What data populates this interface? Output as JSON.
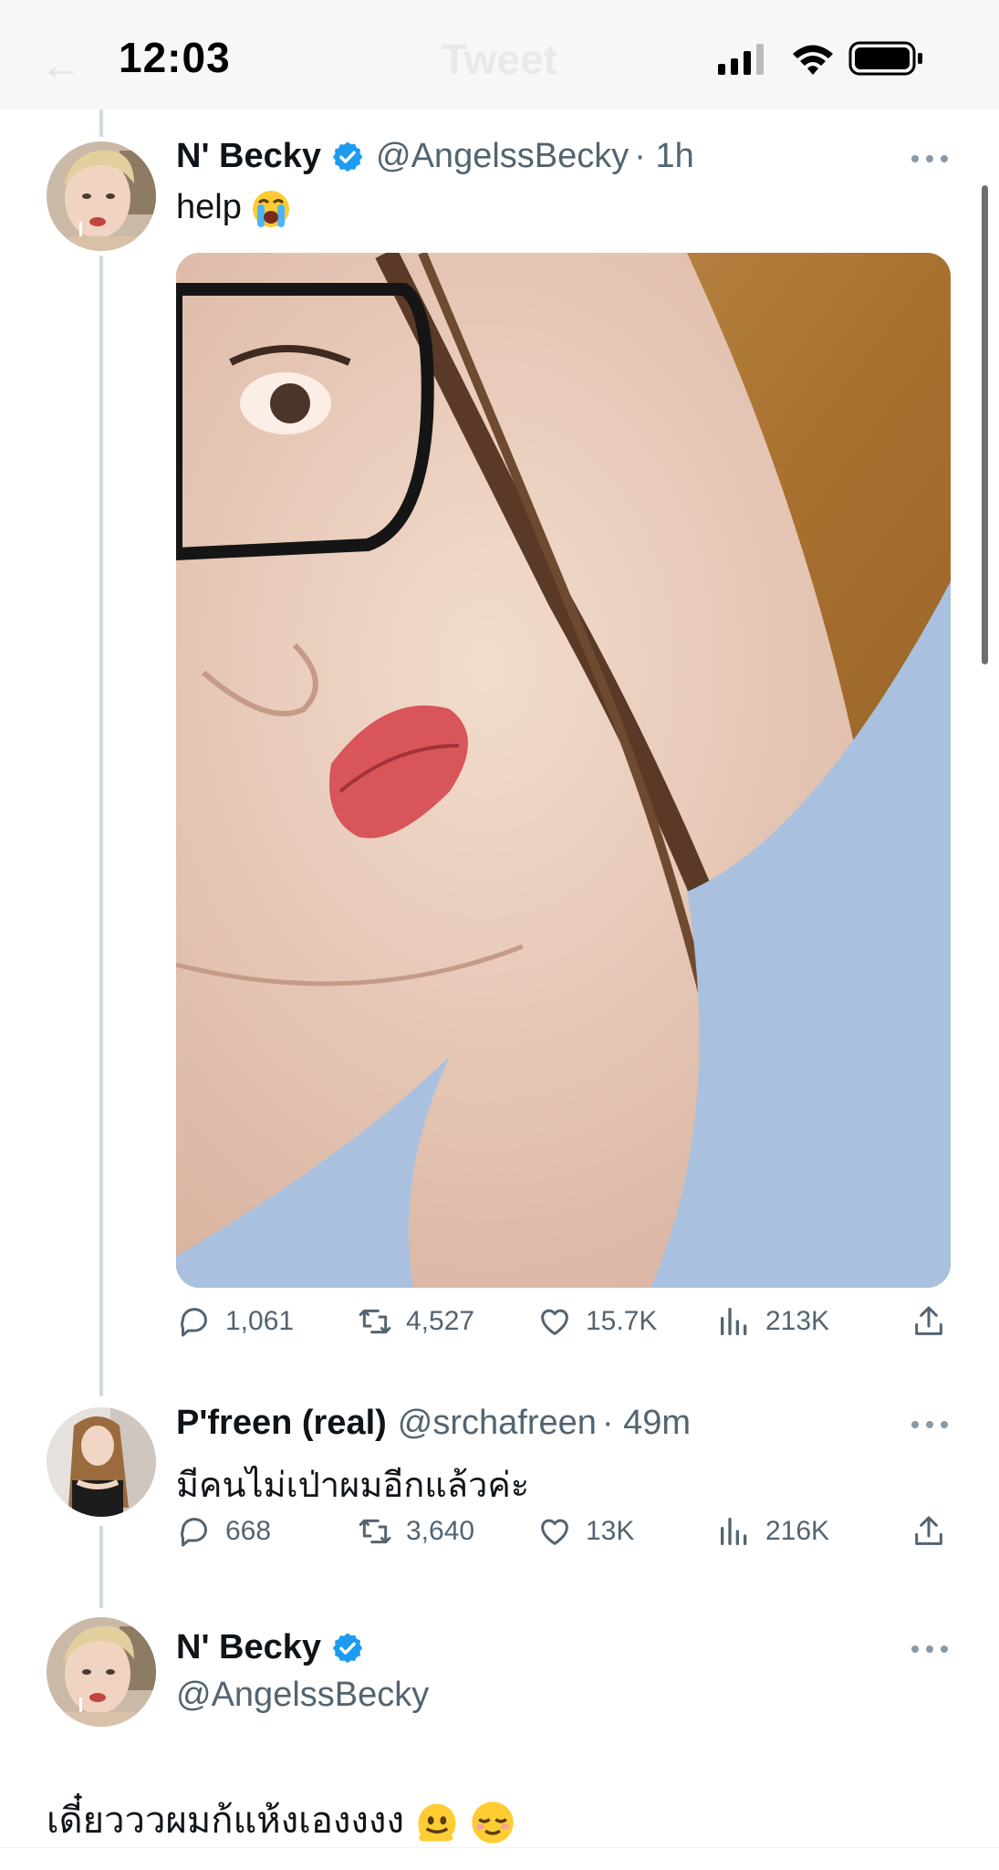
{
  "status_bar": {
    "time": "12:03"
  },
  "nav": {
    "title": "Tweet"
  },
  "tweets": [
    {
      "author": "N' Becky",
      "verified": true,
      "handle": "@AngelssBecky",
      "time": "· 1h",
      "text": "help",
      "text_emoji": "loudly-crying-face-emoji",
      "media": "photo",
      "stats": {
        "replies": "1,061",
        "retweets": "4,527",
        "likes": "15.7K",
        "views": "213K"
      }
    },
    {
      "author": "P'freen (real)",
      "verified": false,
      "handle": "@srchafreen",
      "time": "· 49m",
      "text": "มีคนไม่เป่าผมอีกแล้วค่ะ",
      "stats": {
        "replies": "668",
        "retweets": "3,640",
        "likes": "13K",
        "views": "216K"
      }
    },
    {
      "author": "N' Becky",
      "verified": true,
      "handle": "@AngelssBecky",
      "text": "เดี๋ยวววผมก้แห้งเองงงง",
      "text_emojis": [
        "melting-face-emoji",
        "relieved-face-emoji"
      ]
    }
  ],
  "colors": {
    "verified": "#1d9bf0",
    "secondary": "#536471",
    "thread_line": "#cfd9de"
  }
}
